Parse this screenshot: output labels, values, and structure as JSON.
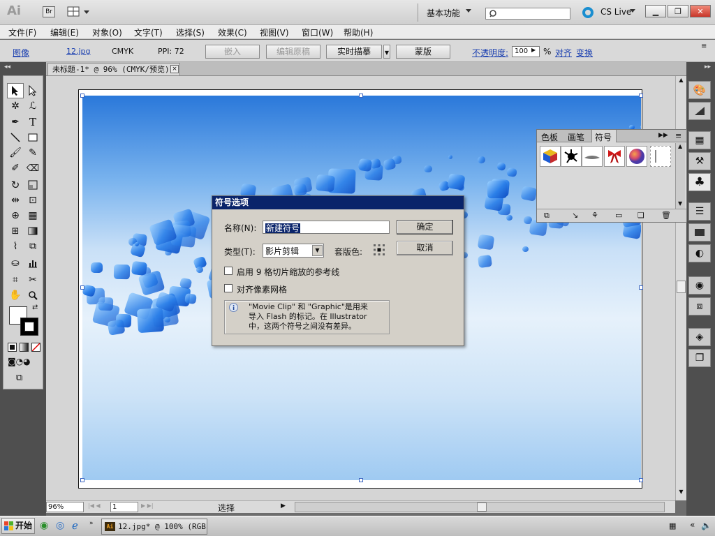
{
  "app": {
    "logo": "Ai",
    "bridge": "Br",
    "workspace": "基本功能",
    "cs_live": "CS Live"
  },
  "menu": [
    "文件(F)",
    "编辑(E)",
    "对象(O)",
    "文字(T)",
    "选择(S)",
    "效果(C)",
    "视图(V)",
    "窗口(W)",
    "帮助(H)"
  ],
  "control_bar": {
    "image_label": "图像",
    "file_name": "12.jpg",
    "color_mode": "CMYK",
    "ppi": "PPI: 72",
    "embed": "嵌入",
    "edit_original": "编辑原稿",
    "live_trace": "实时描摹",
    "mask": "蒙版",
    "opacity_label": "不透明度:",
    "opacity_value": "100",
    "percent": "%",
    "align": "对齐",
    "transform": "变换"
  },
  "doc_tab": {
    "title": "未标题-1* @ 96% (CMYK/预览)",
    "close": "×"
  },
  "status": {
    "zoom": "96%",
    "page": "1",
    "status_menu": "选择"
  },
  "dialog": {
    "title": "符号选项",
    "name_label": "名称(N):",
    "name_value": "新建符号",
    "type_label": "类型(T):",
    "type_value": "影片剪辑",
    "registration_label": "套版色:",
    "ok": "确定",
    "cancel": "取消",
    "check_9slice": "启用 9 格切片缩放的参考线",
    "check_pixel": "对齐像素网格",
    "info_line1": "\"Movie Clip\" 和 \"Graphic\"是用来",
    "info_line2": "导入 Flash 的标记。在 Illustrator",
    "info_line3": "中，这两个符号之间没有差异。"
  },
  "symbols_panel": {
    "tabs": [
      "色板",
      "画笔",
      "符号"
    ]
  },
  "taskbar": {
    "start": "开始",
    "task": "12.jpg* @ 100% (RGB..."
  },
  "colors": {
    "accent": "#0a246a",
    "link": "#1a3fb0",
    "panel": "#4f4f4f"
  }
}
